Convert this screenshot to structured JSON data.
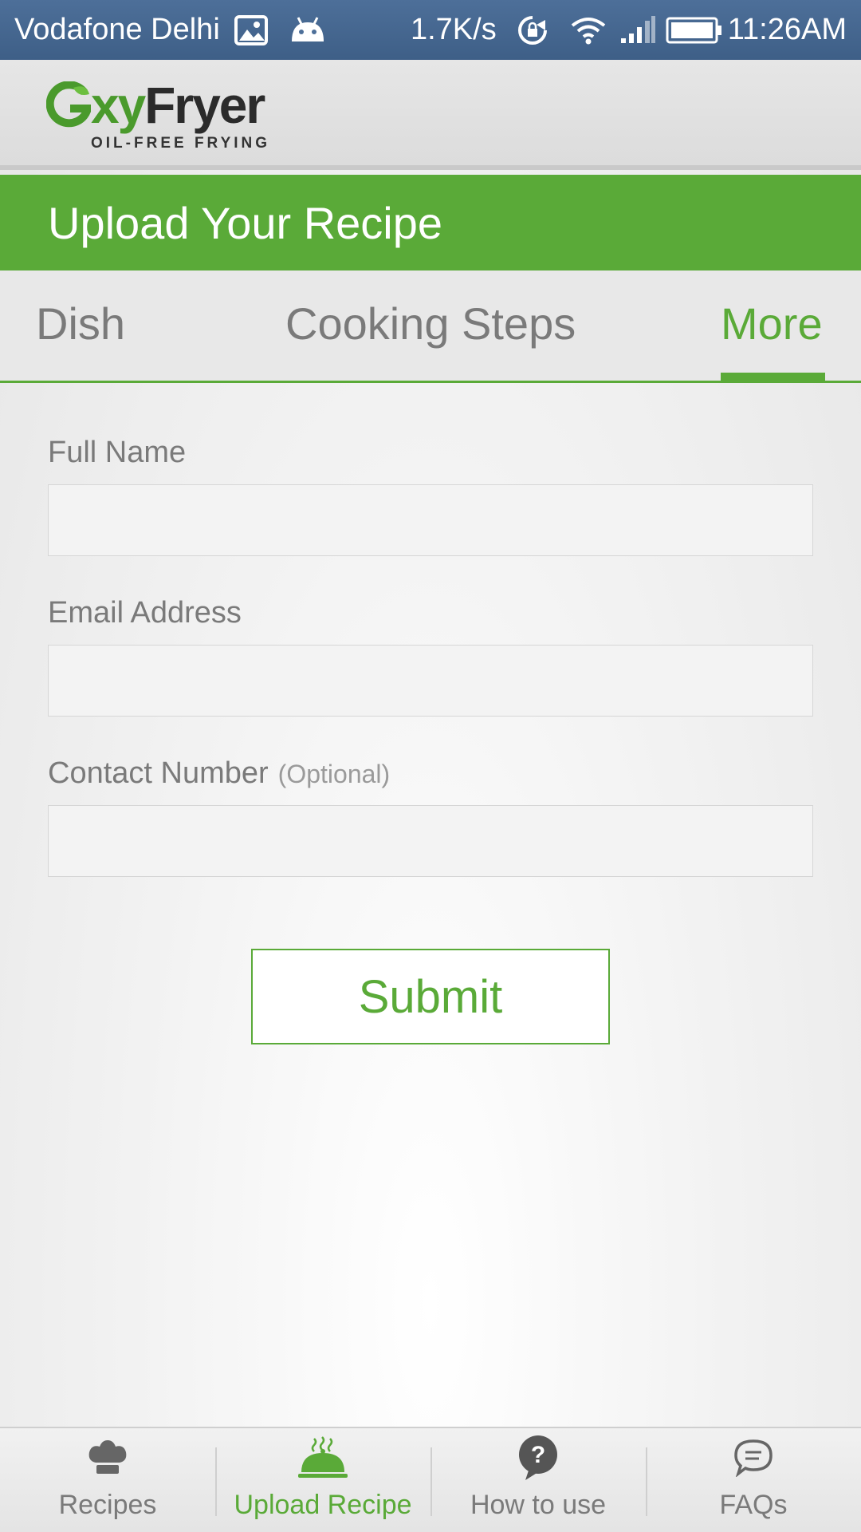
{
  "status_bar": {
    "carrier": "Vodafone Delhi",
    "speed": "1.7K/s",
    "time": "11:26AM",
    "icons": [
      "image-icon",
      "android-icon",
      "rotation-lock-icon",
      "wifi-icon",
      "signal-icon",
      "battery-icon"
    ]
  },
  "header": {
    "logo_prefix": "O",
    "logo_oxy": "xy",
    "logo_brand": "Fryer",
    "logo_tagline": "OIL-FREE FRYING"
  },
  "title_bar": {
    "title": "Upload Your Recipe"
  },
  "tabs": [
    {
      "label": "Dish",
      "active": false
    },
    {
      "label": "Cooking Steps",
      "active": false
    },
    {
      "label": "More",
      "active": true
    }
  ],
  "form": {
    "full_name": {
      "label": "Full Name",
      "value": ""
    },
    "email": {
      "label": "Email Address",
      "value": ""
    },
    "contact": {
      "label": "Contact Number",
      "optional": "(Optional)",
      "value": ""
    },
    "submit_label": "Submit"
  },
  "bottom_nav": [
    {
      "label": "Recipes",
      "icon": "chef-hat-icon",
      "active": false
    },
    {
      "label": "Upload Recipe",
      "icon": "serving-cloche-icon",
      "active": true
    },
    {
      "label": "How to use",
      "icon": "question-icon",
      "active": false
    },
    {
      "label": "FAQs",
      "icon": "chat-bubble-icon",
      "active": false
    }
  ],
  "colors": {
    "accent": "#5aaa38",
    "status_bar": "#46668f",
    "text_muted": "#7a7a7a"
  }
}
